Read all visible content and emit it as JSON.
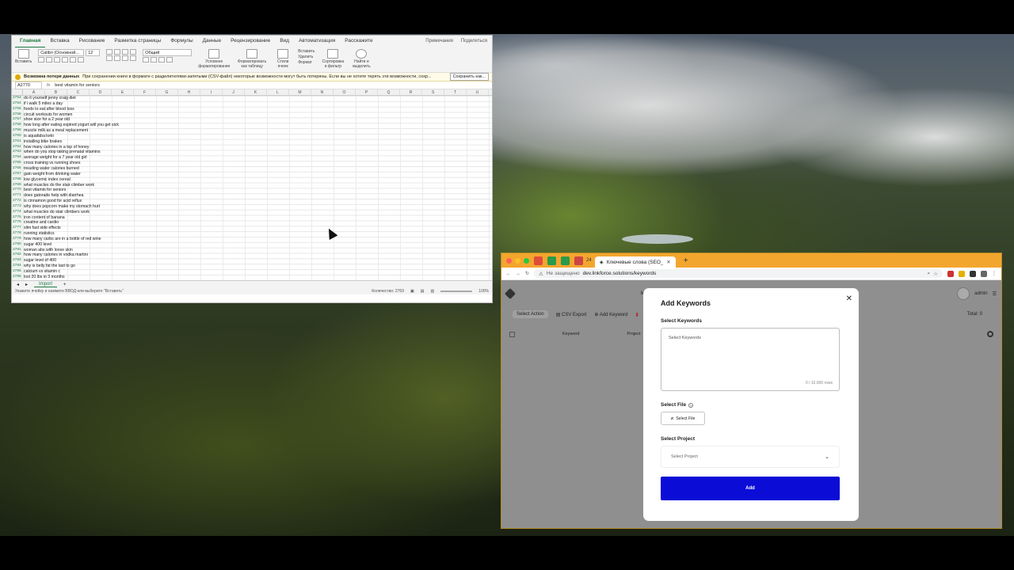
{
  "excel": {
    "tabs": [
      "Главная",
      "Вставка",
      "Рисование",
      "Разметка страницы",
      "Формулы",
      "Данные",
      "Рецензирование",
      "Вид",
      "Автоматизация",
      "Расскажите"
    ],
    "tab_right": [
      "Примечания",
      "Поделиться"
    ],
    "ribbon": {
      "paste": "Вставить",
      "font": "Calibri (Основной...",
      "size": "12",
      "number_format": "Общий",
      "cond_format": "Условное форматирование",
      "format_table": "Форматировать как таблицу",
      "cell_styles": "Стили ячеек",
      "insert": "Вставить",
      "delete": "Удалить",
      "format": "Формат",
      "sort_filter": "Сортировка и фильтр",
      "find_select": "Найти и выделить"
    },
    "warning": {
      "title": "Возможна потеря данных",
      "text": "При сохранении книги в формате с разделителями-запятыми (CSV-файл) некоторые возможности могут быть потеряны. Если вы не хотите терять эти возможности, сохр...",
      "button": "Сохранить как..."
    },
    "name_box": "A2770",
    "formula": "best vitamin for seniors",
    "columns": [
      "A",
      "B",
      "C",
      "D",
      "E",
      "F",
      "G",
      "H",
      "I",
      "J",
      "K",
      "L",
      "M",
      "N",
      "O",
      "P",
      "Q",
      "R",
      "S",
      "T",
      "U"
    ],
    "rows": [
      {
        "n": "2753",
        "t": "do it yourself jenny craig diet"
      },
      {
        "n": "2754",
        "t": "if i walk 5 miles a day"
      },
      {
        "n": "2755",
        "t": "foods to eat after blood loss"
      },
      {
        "n": "2756",
        "t": "circuit workouts for women"
      },
      {
        "n": "2757",
        "t": "shoe size for a 2 year old"
      },
      {
        "n": "2758",
        "t": "how long after eating expired yogurt will you get sick"
      },
      {
        "n": "2759",
        "t": "muscle milk as a meal replacement"
      },
      {
        "n": "2760",
        "t": "is aquafaba keto"
      },
      {
        "n": "2761",
        "t": "installing bike brakes"
      },
      {
        "n": "2762",
        "t": "how many calories in a tsp of honey"
      },
      {
        "n": "2763",
        "t": "when do you stop taking prenatal vitamins"
      },
      {
        "n": "2764",
        "t": "average weight for a 7 year old girl"
      },
      {
        "n": "2765",
        "t": "cross training vs running shoes"
      },
      {
        "n": "2766",
        "t": "treading water calories burned"
      },
      {
        "n": "2767",
        "t": "gain weight from drinking water"
      },
      {
        "n": "2768",
        "t": "low glycemic index cereal"
      },
      {
        "n": "2769",
        "t": "what muscles do the stair climber work"
      },
      {
        "n": "2770",
        "t": "best vitamin for seniors"
      },
      {
        "n": "2771",
        "t": "does gatorade help with diarrhea"
      },
      {
        "n": "2772",
        "t": "is cinnamon good for acid reflux"
      },
      {
        "n": "2773",
        "t": "why does popcorn make my stomach hurt"
      },
      {
        "n": "2774",
        "t": "what muscles do stair climbers work"
      },
      {
        "n": "2775",
        "t": "iron content of banana"
      },
      {
        "n": "2776",
        "t": "creatine and cardio"
      },
      {
        "n": "2777",
        "t": "slim fast side effects"
      },
      {
        "n": "2778",
        "t": "running statistics"
      },
      {
        "n": "2779",
        "t": "how many carbs are in a bottle of red wine"
      },
      {
        "n": "2780",
        "t": "sugar 400 level"
      },
      {
        "n": "2781",
        "t": "woman abs with loose skin"
      },
      {
        "n": "2782",
        "t": "how many calories in vodka martini"
      },
      {
        "n": "2783",
        "t": "sugar level of 400"
      },
      {
        "n": "2784",
        "t": "why is belly fat the last to go"
      },
      {
        "n": "2785",
        "t": "calcium vs vitamin c"
      },
      {
        "n": "2786",
        "t": "lost 20 lbs in 3 months"
      }
    ],
    "sheet": "Import",
    "status_left": "Укажите ячейку и нажмите ВВОД или выберите \"Вставить\"",
    "status_count": "Количество: 2769",
    "zoom": "100%"
  },
  "browser": {
    "tab_count": "24",
    "tab_title": "Ключевые слова (SEO_ADM",
    "insecure": "Не защищено",
    "url": "dev.linkforce.solutions/keywords",
    "colors": {
      "tabbar": "#f3a62e",
      "primary": "#0b0cd6"
    }
  },
  "app": {
    "nav_partial": "Im",
    "user": "admin",
    "select_action": "Select Action",
    "csv_export": "CSV Export",
    "add_keyword": "Add Keyword",
    "total": "Total:  0",
    "col_keyword": "Keyword",
    "col_project": "Project"
  },
  "modal": {
    "title": "Add Keywords",
    "select_keywords_label": "Select Keywords",
    "keywords_placeholder": "Select Keywords",
    "counter": "0 / 10.000 rows",
    "select_file_label": "Select File",
    "select_file_button": "Select File",
    "select_project_label": "Select Project",
    "project_placeholder": "Select Project",
    "add_button": "Add"
  }
}
